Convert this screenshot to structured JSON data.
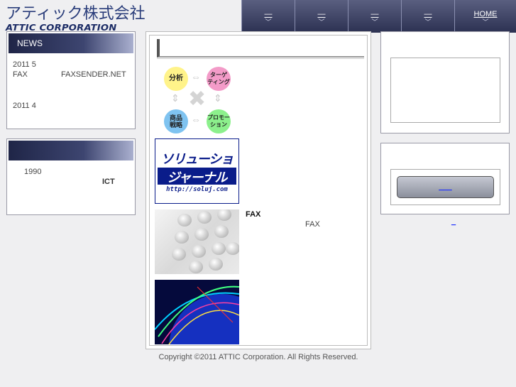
{
  "logo": {
    "japanese": "アティック株式会社",
    "english": "ATTIC CORPORATION"
  },
  "nav": {
    "items": [
      {
        "label": "—",
        "chevron": "﹀"
      },
      {
        "label": "—",
        "chevron": "﹀"
      },
      {
        "label": "—",
        "chevron": "﹀"
      },
      {
        "label": "—",
        "chevron": "﹀"
      },
      {
        "label": "HOME",
        "chevron": "﹀"
      }
    ]
  },
  "news": {
    "title": "NEWS",
    "entry1_date": "2011 5",
    "entry1_left": "FAX",
    "entry1_right": "FAXSENDER.NET",
    "entry2_date": "2011 4"
  },
  "about": {
    "title": "",
    "year": "1990",
    "keyword": "ICT"
  },
  "main": {
    "diagram": {
      "analysis": "分析",
      "targeting": "ターゲ\nティング",
      "product": "商品\n戦略",
      "promotion": "プロモー\nション"
    },
    "banner": {
      "line1": "ソリューション",
      "line2": "ジャーナル",
      "url": "http://soluj.com"
    },
    "fax_title": "FAX",
    "fax_text": "FAX"
  },
  "footer": {
    "copyright": "Copyright ©2011 ATTIC Corporation. All Rights Reserved."
  },
  "right": {
    "button_label": "___",
    "link_label": "_"
  },
  "colors": {
    "nav_bg": "#3d4264",
    "title_bar": "#1f2547",
    "banner_blue": "#0a1c8a"
  }
}
